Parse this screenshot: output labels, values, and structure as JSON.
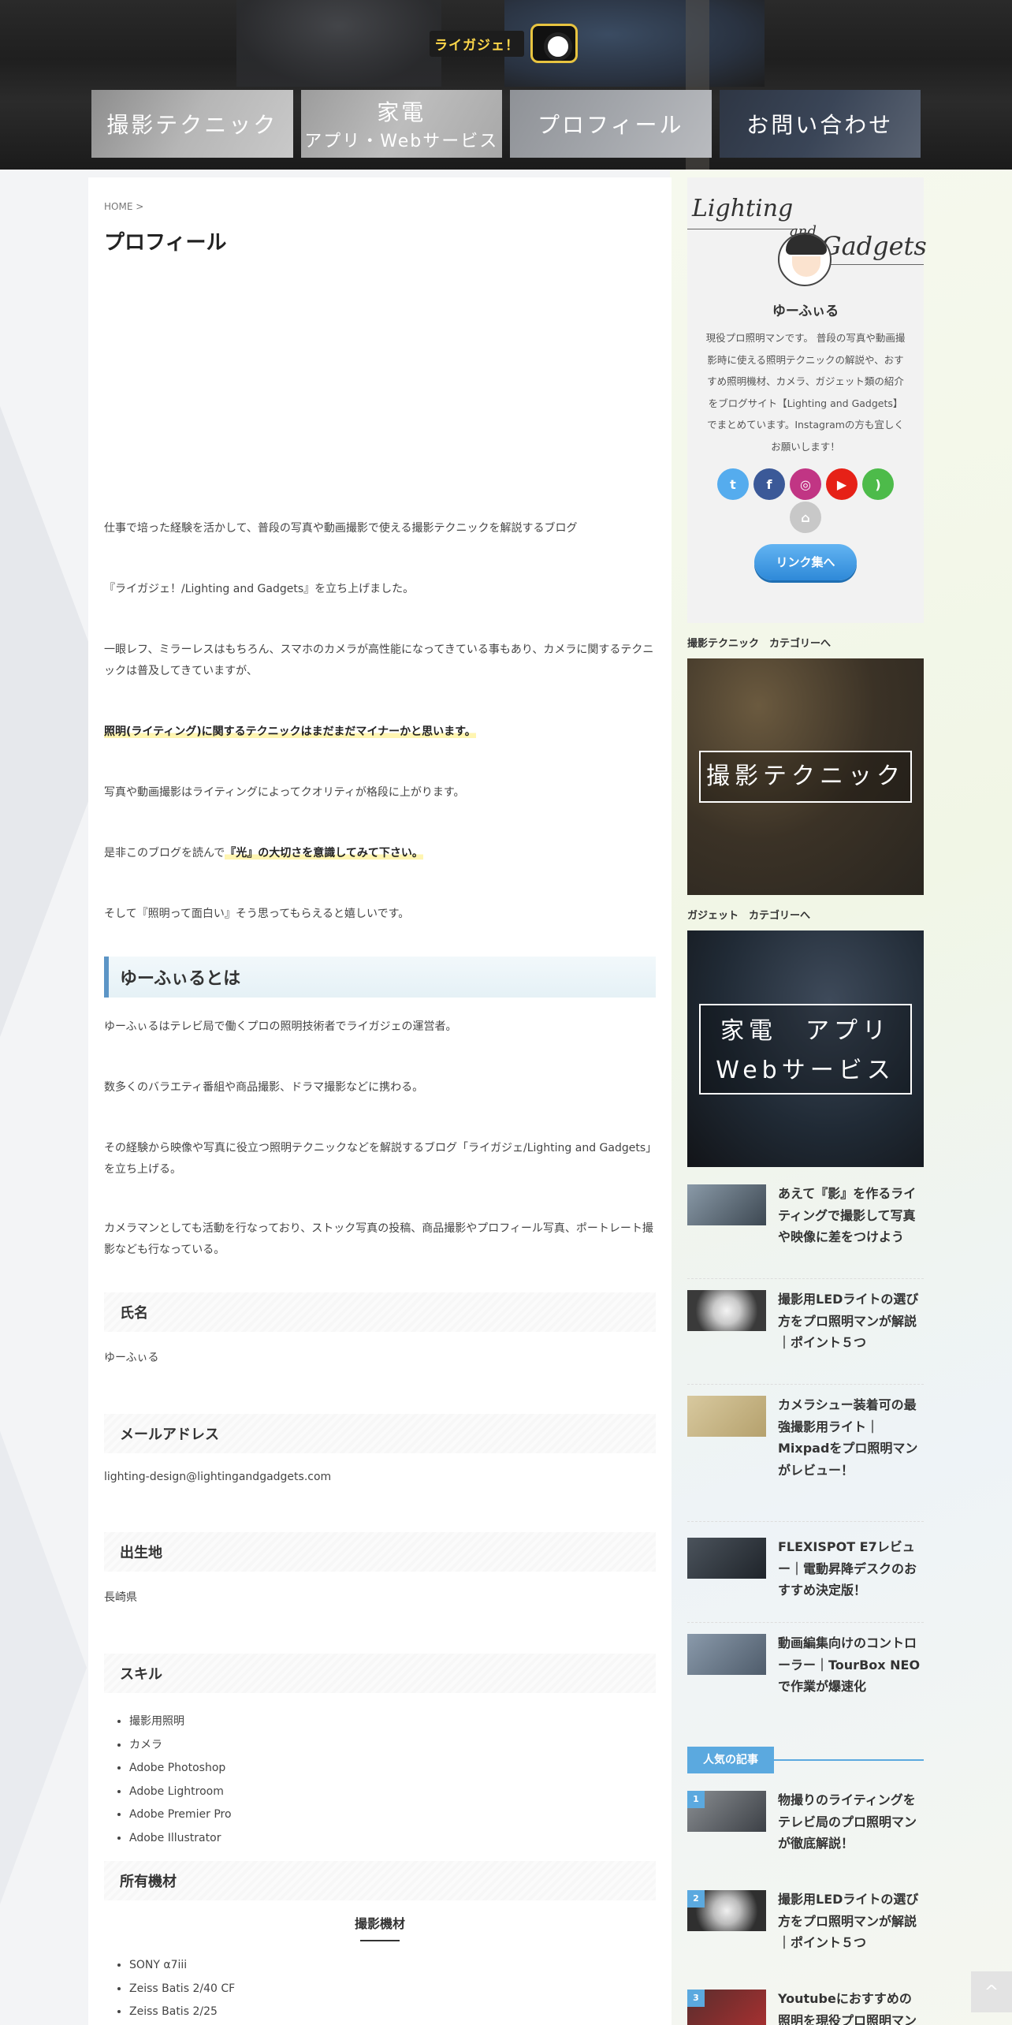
{
  "header": {
    "logo_text": "ライガジェ！",
    "nav": [
      {
        "label": "撮影テクニック",
        "sub": ""
      },
      {
        "label": "家電",
        "sub": "アプリ・Webサービス"
      },
      {
        "label": "プロフィール",
        "sub": ""
      },
      {
        "label": "お問い合わせ",
        "sub": ""
      }
    ]
  },
  "main": {
    "breadcrumb": "HOME >",
    "title": "プロフィール",
    "intro": [
      "仕事で培った経験を活かして、普段の写真や動画撮影で使える撮影テクニックを解説するブログ",
      "『ライガジェ！/Lighting and Gadgets』を立ち上げました。",
      "一眼レフ、ミラーレスはもちろん、スマホのカメラが高性能になってきている事もあり、カメラに関するテクニックは普及してきていますが、",
      "照明(ライティング)に関するテクニックはまだまだマイナーかと思います。",
      "写真や動画撮影はライティングによってクオリティが格段に上がります。"
    ],
    "para_pre": "是非このブログを読んで",
    "para_hl": "『光』の大切さを意識してみて下さい。",
    "para_last": "そして『照明って面白い』そう思ってもらえると嬉しいです。",
    "h2": "ゆーふぃるとは",
    "about": [
      "ゆーふぃるはテレビ局で働くプロの照明技術者でライガジェの運営者。",
      "数多くのバラエティ番組や商品撮影、ドラマ撮影などに携わる。",
      "その経験から映像や写真に役立つ照明テクニックなどを解説するブログ「ライガジェ/Lighting and Gadgets」を立ち上げる。",
      "カメラマンとしても活動を行なっており、ストック写真の投稿、商品撮影やプロフィール写真、ポートレート撮影なども行なっている。"
    ],
    "name_heading": "氏名",
    "name_value": "ゆーふぃる",
    "email_heading": "メールアドレス",
    "email_value": "lighting-design@lightingandgadgets.com",
    "birthplace_heading": "出生地",
    "birthplace_value": "長崎県",
    "skills_heading": "スキル",
    "skills": [
      "撮影用照明",
      "カメラ",
      "Adobe Photoshop",
      "Adobe Lightroom",
      "Adobe Premier Pro",
      "Adobe Illustrator"
    ],
    "equipment_heading": "所有機材",
    "camera_heading": "撮影機材",
    "equipment": [
      "SONY α7iii",
      "Zeiss Batis 2/40 CF",
      "Zeiss Batis 2/25"
    ]
  },
  "sidebar": {
    "logo": {
      "word1": "Lighting",
      "word2": "and",
      "word3": "Gadgets"
    },
    "name": "ゆーふぃる",
    "desc": "現役プロ照明マンです。 普段の写真や動画撮影時に使える照明テクニックの解説や、おすすめ照明機材、カメラ、ガジェット類の紹介をブログサイト【Lighting and Gadgets】でまとめています。Instagramの方も宜しくお願いします！",
    "social_icons": [
      "twitter-icon",
      "facebook-icon",
      "instagram-icon",
      "youtube-icon",
      "rss-icon",
      "home-icon"
    ],
    "link_button": "リンク集へ",
    "cat1_heading": "撮影テクニック　カテゴリーへ",
    "cat1_banner": "撮影テクニック",
    "cat2_heading": "ガジェット　カテゴリーへ",
    "cat2_banner_1": "家電　アプリ",
    "cat2_banner_2": "Webサービス",
    "posts": [
      "あえて『影』を作るライティングで撮影して写真や映像に差をつけよう",
      "撮影用LEDライトの選び方をプロ照明マンが解説｜ポイント５つ",
      "カメラシュー装着可の最強撮影用ライト｜Mixpadをプロ照明マンがレビュー！",
      "FLEXISPOT E7レビュー｜電動昇降デスクのおすすめ決定版！",
      "動画編集向けのコントローラー｜TourBox NEOで作業が爆速化"
    ],
    "popular_label": "人気の記事",
    "popular": [
      {
        "rank": "1",
        "title": "物撮りのライティングをテレビ局のプロ照明マンが徹底解説！"
      },
      {
        "rank": "2",
        "title": "撮影用LEDライトの選び方をプロ照明マンが解説｜ポイント５つ"
      },
      {
        "rank": "3",
        "title": "Youtubeにおすすめの照明を現役プロ照明マン"
      }
    ]
  },
  "scroll_top": "^"
}
